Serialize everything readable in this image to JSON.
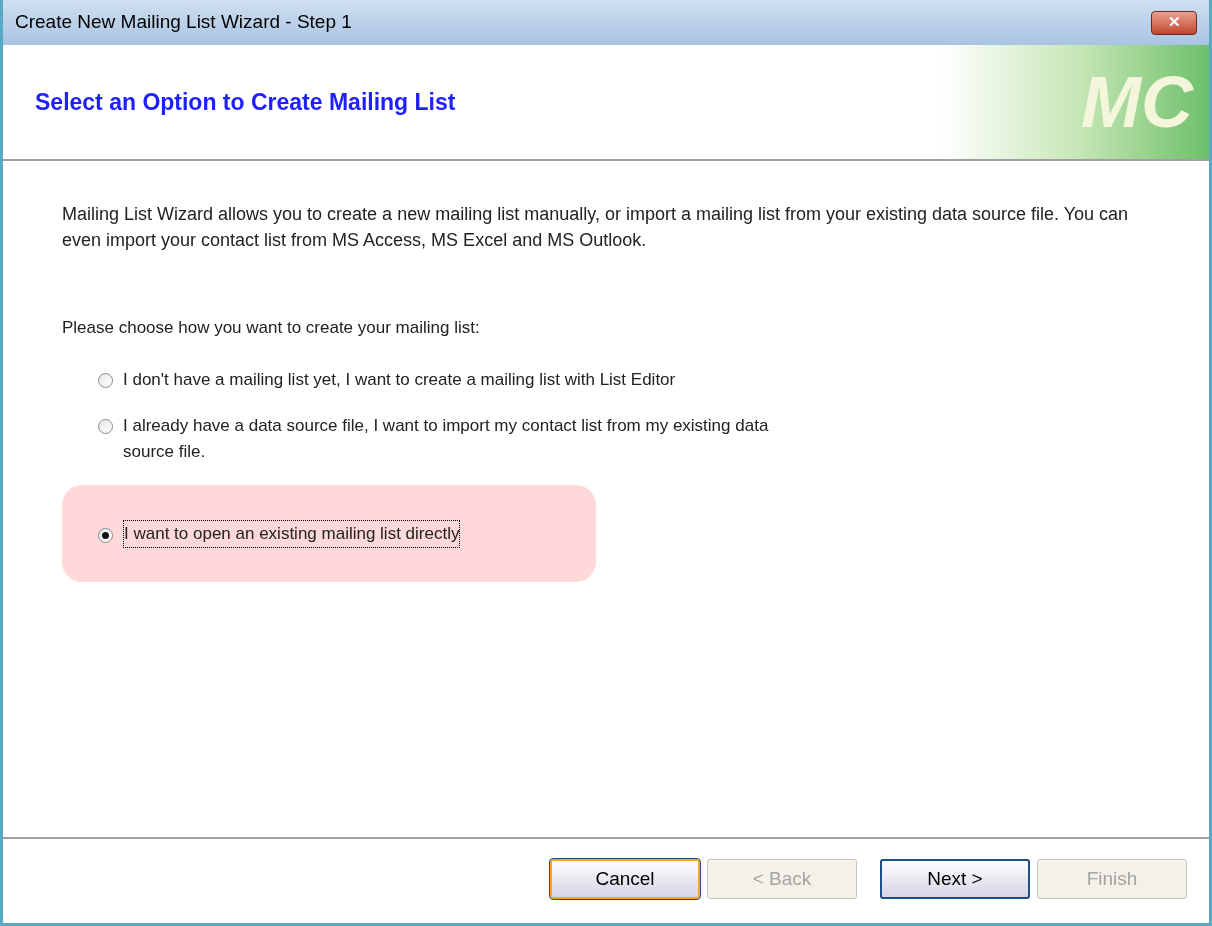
{
  "window": {
    "title": "Create New Mailing List Wizard - Step 1",
    "close_label": "✕"
  },
  "header": {
    "title": "Select an Option to Create Mailing List",
    "logo": "MC"
  },
  "description": "Mailing List Wizard allows you to create a new mailing list manually, or import a mailing list from your existing data source file. You can even import your contact list from MS Access, MS Excel and MS Outlook.",
  "prompt": "Please choose how you want to create your mailing list:",
  "options": [
    {
      "label": "I don't have a mailing list yet, I want to create a mailing list with List Editor",
      "selected": false
    },
    {
      "label": "I already have a data source file, I want to import my contact list from my existing data source file.",
      "selected": false
    },
    {
      "label": "I want to open an existing mailing list directly",
      "selected": true
    }
  ],
  "buttons": [
    {
      "label": "Cancel",
      "disabled": false,
      "focused": true
    },
    {
      "label": "< Back",
      "disabled": true,
      "focused": false
    },
    {
      "label": "Next >",
      "disabled": false,
      "focused": false
    },
    {
      "label": "Finish",
      "disabled": true,
      "focused": false
    }
  ]
}
